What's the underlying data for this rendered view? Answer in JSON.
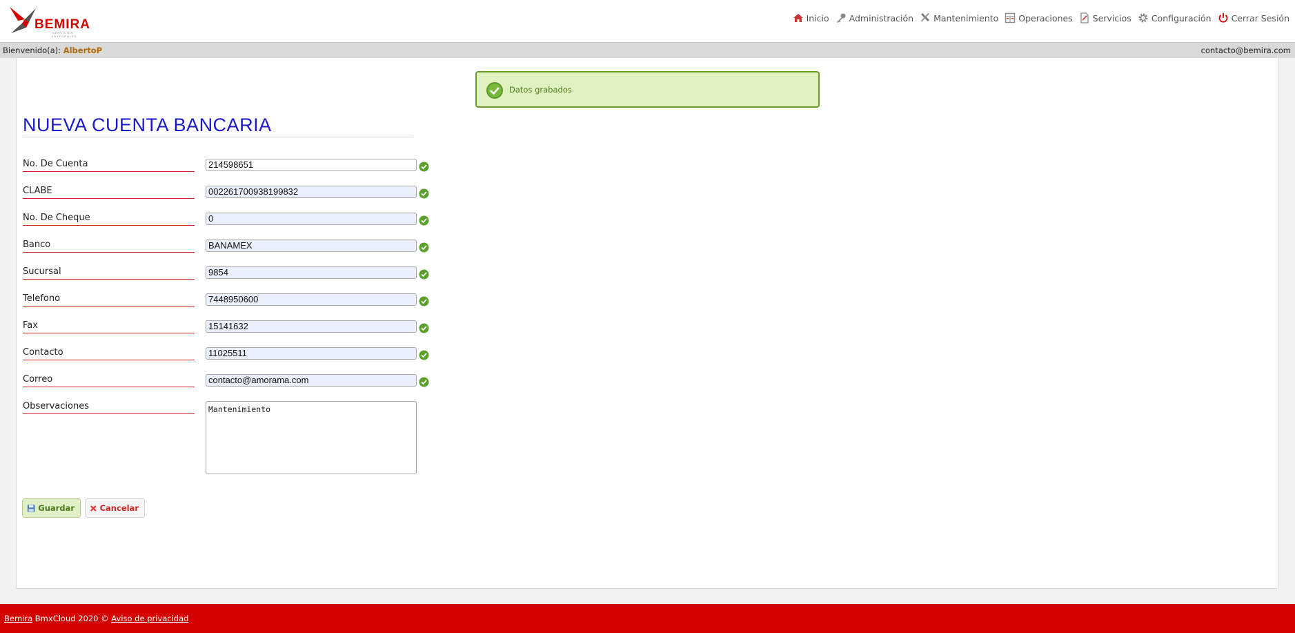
{
  "brand": {
    "name": "BEMIRA",
    "tagline": "SERVICIOS INTEGRALES"
  },
  "nav": [
    {
      "label": "Inicio",
      "icon": "home-icon"
    },
    {
      "label": "Administración",
      "icon": "key-icon"
    },
    {
      "label": "Mantenimiento",
      "icon": "tools-icon"
    },
    {
      "label": "Operaciones",
      "icon": "calculator-icon"
    },
    {
      "label": "Servicios",
      "icon": "document-icon"
    },
    {
      "label": "Configuración",
      "icon": "gear-icon"
    },
    {
      "label": "Cerrar Sesión",
      "icon": "power-icon"
    }
  ],
  "welcome": {
    "prefix": "Bienvenido(a):",
    "user": "AlbertoP",
    "email": "contacto@bemira.com"
  },
  "alert": {
    "message": "Datos grabados"
  },
  "page_title": "NUEVA CUENTA BANCARIA",
  "form": {
    "fields": [
      {
        "label": "No. De Cuenta",
        "value": "214598651"
      },
      {
        "label": "CLABE",
        "value": "002261700938199832"
      },
      {
        "label": "No. De Cheque",
        "value": "0"
      },
      {
        "label": "Banco",
        "value": "BANAMEX"
      },
      {
        "label": "Sucursal",
        "value": "9854"
      },
      {
        "label": "Telefono",
        "value": "7448950600"
      },
      {
        "label": "Fax",
        "value": "15141632"
      },
      {
        "label": "Contacto",
        "value": "11025511"
      },
      {
        "label": "Correo",
        "value": "contacto@amorama.com"
      }
    ],
    "observaciones": {
      "label": "Observaciones",
      "value": "Mantenimiento"
    }
  },
  "buttons": {
    "save": "Guardar",
    "cancel": "Cancelar"
  },
  "footer": {
    "brand_link": "Bemira",
    "text": " BmxCloud 2020 © ",
    "privacy_link": "Aviso de privacidad"
  },
  "colors": {
    "brand_red": "#d40000",
    "title_blue": "#1a1acc",
    "success_green": "#6a9a2a"
  }
}
